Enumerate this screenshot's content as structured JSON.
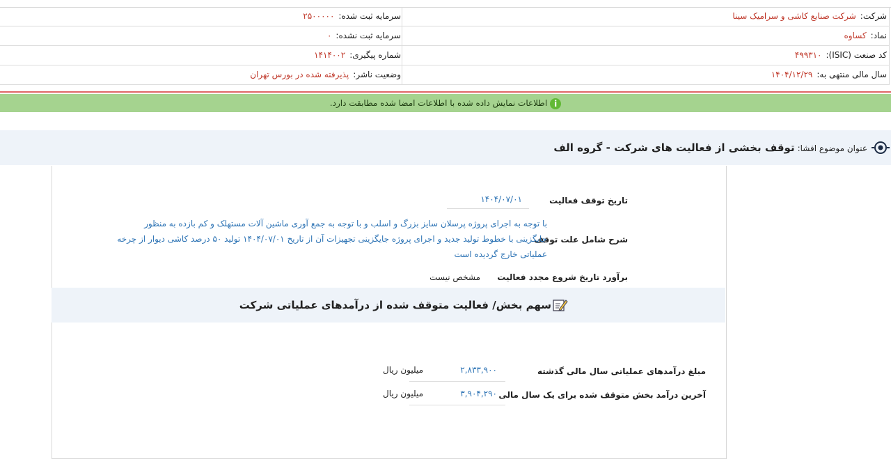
{
  "info": {
    "company_label": "شرکت:",
    "company_value": "شرکت صنایع کاشی و سرامیک سینا",
    "reg_capital_label": "سرمایه ثبت شده:",
    "reg_capital_value": "۲۵۰۰۰۰۰",
    "symbol_label": "نماد:",
    "symbol_value": "کساوه",
    "unreg_capital_label": "سرمایه ثبت نشده:",
    "unreg_capital_value": "۰",
    "isic_label": "کد صنعت (ISIC):",
    "isic_value": "۴۹۹۳۱۰",
    "tracking_label": "شماره پیگیری:",
    "tracking_value": "۱۴۱۴۰۰۲",
    "fiscal_year_label": "سال مالی منتهی به:",
    "fiscal_year_value": "۱۴۰۴/۱۲/۲۹",
    "publisher_status_label": "وضعیت ناشر:",
    "publisher_status_value": "پذیرفته شده در بورس تهران"
  },
  "banner": {
    "text": "اطلاعات نمایش داده شده با اطلاعات امضا شده مطابقت دارد."
  },
  "disclosure": {
    "label": "عنوان موضوع افشا:",
    "title": "توقف بخشی از فعالیت های شرکت - گروه الف"
  },
  "details": {
    "stop_date_label": "تاریخ توقف فعالیت",
    "stop_date_value": "۱۴۰۴/۰۷/۰۱",
    "reason_label": "شرح شامل علت توقف",
    "reason_line1": "با توجه به اجرای پروژه پرسلان سایز بزرگ و اسلب و با توجه به جمع آوری ماشین آلات مستهلک و کم بازده به منظور",
    "reason_line2": "جایگزینی با خطوط تولید جدید و اجرای پروژه جایگزینی تجهیزات آن از تاریخ ۱۴۰۴/۰۷/۰۱ تولید ۵۰ درصد کاشی دیوار از چرخه",
    "reason_line3": "عملیاتی خارج گردیده است",
    "restart_label": "برآورد تاریخ شروع مجدد فعالیت",
    "restart_value": "مشخص نیست"
  },
  "section": {
    "title": "سهم بخش/ فعالیت متوقف شده از درآمدهای عملیاتی شرکت"
  },
  "revenue": {
    "prev_label": "مبلغ درآمدهای عملیاتی سال مالی گذشته",
    "prev_value": "۲,۸۳۳,۹۰۰",
    "prev_unit": "میلیون ریال",
    "last_label": "آخرین درآمد بخش متوقف شده برای یک سال مالی",
    "last_value": "۳,۹۰۴,۲۹۰",
    "last_unit": "میلیون ریال"
  }
}
